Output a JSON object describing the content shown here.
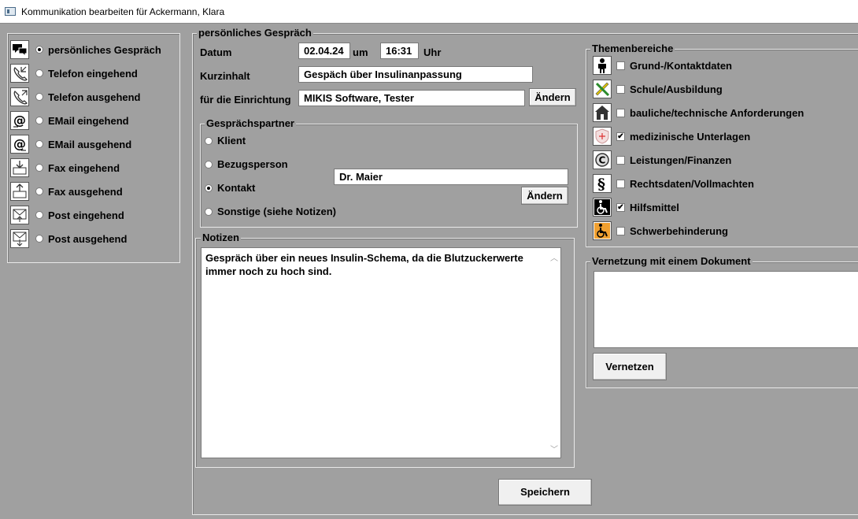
{
  "window": {
    "title": "Kommunikation bearbeiten für Ackermann, Klara"
  },
  "types": [
    {
      "label": "persönliches Gespräch",
      "icon": "speech-bubbles-icon",
      "selected": true
    },
    {
      "label": "Telefon eingehend",
      "icon": "phone-in-icon",
      "selected": false
    },
    {
      "label": "Telefon ausgehend",
      "icon": "phone-out-icon",
      "selected": false
    },
    {
      "label": "EMail eingehend",
      "icon": "email-in-icon",
      "selected": false
    },
    {
      "label": "EMail ausgehend",
      "icon": "email-out-icon",
      "selected": false
    },
    {
      "label": "Fax eingehend",
      "icon": "fax-in-icon",
      "selected": false
    },
    {
      "label": "Fax ausgehend",
      "icon": "fax-out-icon",
      "selected": false
    },
    {
      "label": "Post eingehend",
      "icon": "mail-in-icon",
      "selected": false
    },
    {
      "label": "Post ausgehend",
      "icon": "mail-out-icon",
      "selected": false
    }
  ],
  "form": {
    "legend": "persönliches Gespräch",
    "datum_label": "Datum",
    "datum_value": "02.04.24",
    "um_label": "um",
    "time_value": "16:31",
    "uhr_label": "Uhr",
    "kurzinhalt_label": "Kurzinhalt",
    "kurzinhalt_value": "Gespäch über Insulinanpassung",
    "einrichtung_label": "für die Einrichtung",
    "einrichtung_value": "MIKIS Software, Tester",
    "aendern_label": "Ändern"
  },
  "partner": {
    "legend": "Gesprächspartner",
    "options": [
      {
        "label": "Klient",
        "selected": false
      },
      {
        "label": "Bezugsperson",
        "selected": false
      },
      {
        "label": "Kontakt",
        "selected": true
      },
      {
        "label": "Sonstige (siehe Notizen)",
        "selected": false
      }
    ],
    "name_value": "Dr. Maier",
    "aendern_label": "Ändern"
  },
  "notes": {
    "legend": "Notizen",
    "text": "Gespräch über ein neues Insulin-Schema, da die Blutzuckerwerte immer noch zu hoch sind."
  },
  "topics": {
    "legend": "Themenbereiche",
    "items": [
      {
        "label": "Grund-/Kontaktdaten",
        "icon": "person-icon",
        "checked": false
      },
      {
        "label": "Schule/Ausbildung",
        "icon": "pencil-ruler-icon",
        "checked": false
      },
      {
        "label": "bauliche/technische Anforderungen",
        "icon": "house-icon",
        "checked": false
      },
      {
        "label": "medizinische Unterlagen",
        "icon": "medical-icon",
        "checked": true
      },
      {
        "label": "Leistungen/Finanzen",
        "icon": "copyright-coin-icon",
        "checked": false
      },
      {
        "label": "Rechtsdaten/Vollmachten",
        "icon": "paragraph-icon",
        "checked": false
      },
      {
        "label": "Hilfsmittel",
        "icon": "wheelchair-icon",
        "checked": true
      },
      {
        "label": "Schwerbehinderung",
        "icon": "wheelchair-orange-icon",
        "checked": false
      }
    ]
  },
  "link": {
    "legend": "Vernetzung mit einem Dokument",
    "button_label": "Vernetzen"
  },
  "save_label": "Speichern"
}
